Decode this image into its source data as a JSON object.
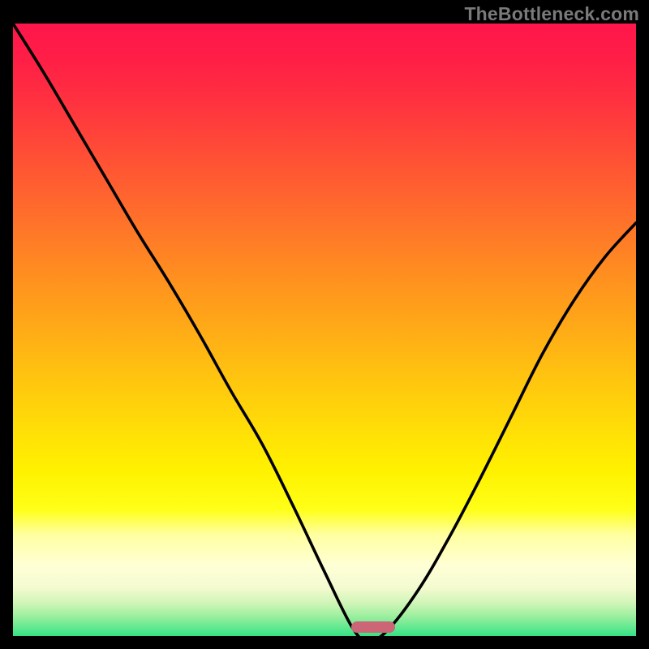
{
  "watermark": "TheBottleneck.com",
  "gradient_stops": [
    {
      "offset": 0.0,
      "color": "#ff154b"
    },
    {
      "offset": 0.06,
      "color": "#ff1f46"
    },
    {
      "offset": 0.12,
      "color": "#ff3040"
    },
    {
      "offset": 0.18,
      "color": "#ff4439"
    },
    {
      "offset": 0.24,
      "color": "#ff5832"
    },
    {
      "offset": 0.3,
      "color": "#ff6c2c"
    },
    {
      "offset": 0.36,
      "color": "#ff8025"
    },
    {
      "offset": 0.42,
      "color": "#ff941e"
    },
    {
      "offset": 0.48,
      "color": "#ffa718"
    },
    {
      "offset": 0.54,
      "color": "#ffbb12"
    },
    {
      "offset": 0.6,
      "color": "#ffce0c"
    },
    {
      "offset": 0.66,
      "color": "#ffe106"
    },
    {
      "offset": 0.72,
      "color": "#fff200"
    },
    {
      "offset": 0.78,
      "color": "#ffff18"
    },
    {
      "offset": 0.82,
      "color": "#ffffa0"
    },
    {
      "offset": 0.87,
      "color": "#ffffd6"
    },
    {
      "offset": 0.905,
      "color": "#f4fbd0"
    },
    {
      "offset": 0.93,
      "color": "#d0f5b8"
    },
    {
      "offset": 0.95,
      "color": "#a0efa0"
    },
    {
      "offset": 0.97,
      "color": "#60e890"
    },
    {
      "offset": 0.985,
      "color": "#2ee084"
    },
    {
      "offset": 1.0,
      "color": "#17dd7f"
    }
  ],
  "marker": {
    "x_frac": 0.5775,
    "y_frac": 0.985,
    "color": "#cc6677"
  },
  "chart_data": {
    "type": "line",
    "title": "",
    "xlabel": "",
    "ylabel": "",
    "xlim": [
      0,
      1
    ],
    "ylim": [
      0,
      1
    ],
    "series": [
      {
        "name": "bottleneck-curve",
        "x": [
          0.0,
          0.05,
          0.1,
          0.15,
          0.2,
          0.25,
          0.3,
          0.35,
          0.4,
          0.45,
          0.5,
          0.545,
          0.57,
          0.6,
          0.65,
          0.7,
          0.75,
          0.8,
          0.85,
          0.9,
          0.95,
          1.0
        ],
        "y": [
          1.0,
          0.92,
          0.835,
          0.75,
          0.665,
          0.585,
          0.5,
          0.41,
          0.325,
          0.225,
          0.12,
          0.03,
          0.01,
          0.025,
          0.09,
          0.175,
          0.27,
          0.37,
          0.47,
          0.555,
          0.625,
          0.68
        ]
      }
    ],
    "annotations": [
      {
        "text": "TheBottleneck.com",
        "role": "watermark"
      }
    ],
    "highlight": {
      "x": 0.5775,
      "y": 0.015
    }
  }
}
